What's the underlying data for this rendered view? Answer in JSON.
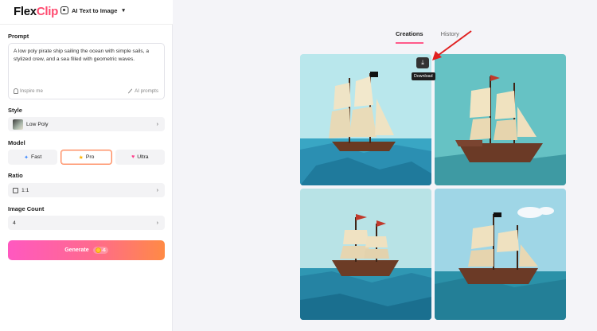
{
  "header": {
    "logo_first": "Flex",
    "logo_second": "Clip",
    "tool_label": "AI Text to Image"
  },
  "sidebar": {
    "prompt_label": "Prompt",
    "prompt_text": "A low poly pirate ship sailing the ocean with simple sails, a stylized crew, and a sea filled with geometric waves.",
    "inspire_label": "Inspire me",
    "ai_prompts_label": "AI prompts",
    "style_label": "Style",
    "style_value": "Low Poly",
    "model_label": "Model",
    "models": [
      {
        "label": "Fast",
        "icon": "bolt-icon"
      },
      {
        "label": "Pro",
        "icon": "star-icon"
      },
      {
        "label": "Ultra",
        "icon": "heart-icon"
      }
    ],
    "model_selected": "Pro",
    "ratio_label": "Ratio",
    "ratio_value": "1:1",
    "count_label": "Image Count",
    "count_value": "4",
    "generate_label": "Generate",
    "generate_cost": "-6"
  },
  "main": {
    "tabs": [
      {
        "label": "Creations",
        "active": true
      },
      {
        "label": "History",
        "active": false
      }
    ],
    "download_tooltip": "Download"
  },
  "colors": {
    "accent_pink": "#ff58c0",
    "accent_orange": "#ff8a45",
    "tab_underline": "#ff5a8a",
    "annotation_arrow": "#e02020"
  }
}
